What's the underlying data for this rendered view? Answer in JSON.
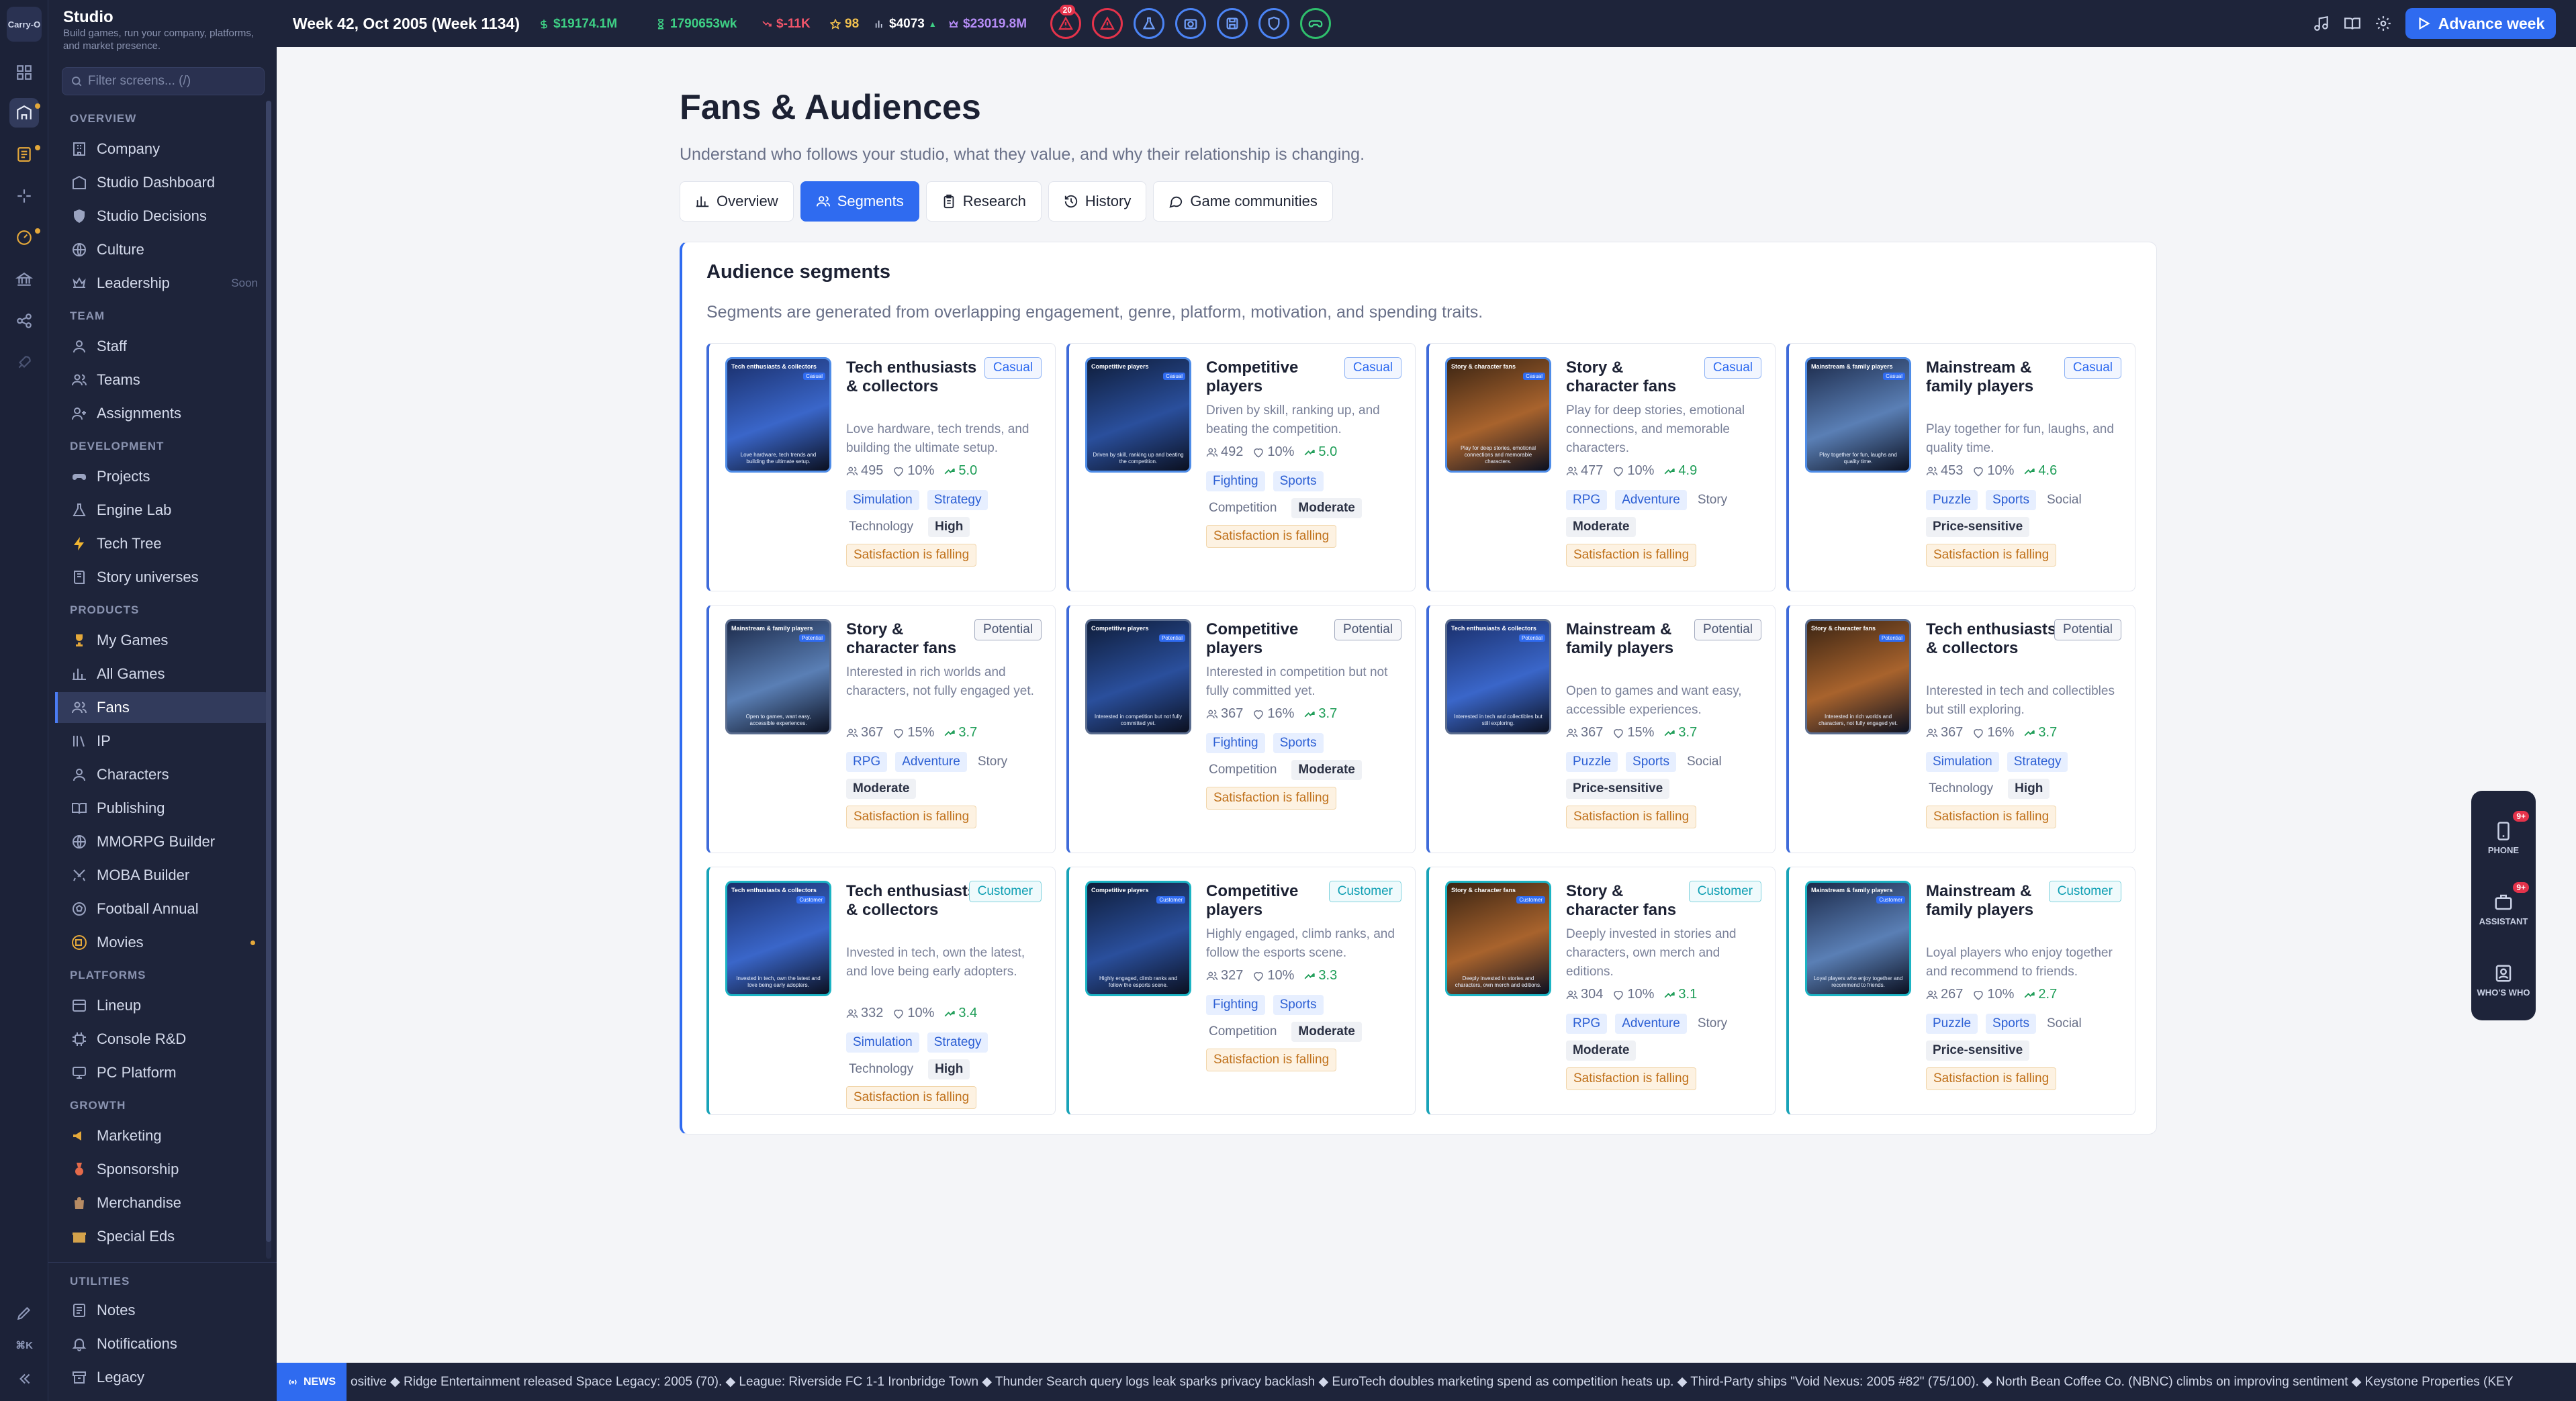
{
  "app": {
    "name": "Studio",
    "subtitle": "Build games, run your company, platforms, and market presence.",
    "filter_placeholder": "Filter screens... (/)",
    "logo_text": "Carry-O"
  },
  "topbar": {
    "week": "Week 42, Oct 2005 (Week 1134)",
    "cash": "$19174.1M",
    "weekly": "1790653wk",
    "delta": "$-11K",
    "reputation": "98",
    "price": "$4073",
    "valuation": "$23019.8M",
    "alert_badge": "20",
    "advance_label": "Advance week"
  },
  "sidebar": {
    "sections": [
      {
        "label": "OVERVIEW",
        "items": [
          {
            "label": "Company",
            "icon": "building-icon"
          },
          {
            "label": "Studio Dashboard",
            "icon": "dashboard-icon"
          },
          {
            "label": "Studio Decisions",
            "icon": "shield-icon"
          },
          {
            "label": "Culture",
            "icon": "globe-icon"
          },
          {
            "label": "Leadership",
            "icon": "crown-icon",
            "note": "Soon"
          }
        ]
      },
      {
        "label": "TEAM",
        "items": [
          {
            "label": "Staff",
            "icon": "user-icon"
          },
          {
            "label": "Teams",
            "icon": "users-icon"
          },
          {
            "label": "Assignments",
            "icon": "user-plus-icon"
          }
        ]
      },
      {
        "label": "DEVELOPMENT",
        "items": [
          {
            "label": "Projects",
            "icon": "gamepad-icon"
          },
          {
            "label": "Engine Lab",
            "icon": "flask-icon"
          },
          {
            "label": "Tech Tree",
            "icon": "bolt-icon"
          },
          {
            "label": "Story universes",
            "icon": "book-icon"
          }
        ]
      },
      {
        "label": "PRODUCTS",
        "items": [
          {
            "label": "My Games",
            "icon": "trophy-icon"
          },
          {
            "label": "All Games",
            "icon": "bar-chart-icon"
          },
          {
            "label": "Fans",
            "icon": "users-icon",
            "active": true
          },
          {
            "label": "IP",
            "icon": "library-icon"
          },
          {
            "label": "Characters",
            "icon": "user-icon"
          },
          {
            "label": "Publishing",
            "icon": "book-open-icon"
          },
          {
            "label": "MMORPG Builder",
            "icon": "globe-icon"
          },
          {
            "label": "MOBA Builder",
            "icon": "swords-icon"
          },
          {
            "label": "Football Annual",
            "icon": "ball-icon"
          },
          {
            "label": "Movies",
            "icon": "film-icon",
            "dot": true
          }
        ]
      },
      {
        "label": "PLATFORMS",
        "items": [
          {
            "label": "Lineup",
            "icon": "layers-icon"
          },
          {
            "label": "Console R&D",
            "icon": "chip-icon"
          },
          {
            "label": "PC Platform",
            "icon": "monitor-icon"
          }
        ]
      },
      {
        "label": "GROWTH",
        "items": [
          {
            "label": "Marketing",
            "icon": "megaphone-icon"
          },
          {
            "label": "Sponsorship",
            "icon": "medal-icon"
          },
          {
            "label": "Merchandise",
            "icon": "bag-icon"
          },
          {
            "label": "Special Eds",
            "icon": "gift-icon"
          }
        ]
      }
    ],
    "utilities_label": "UTILITIES",
    "utilities": [
      {
        "label": "Notes",
        "icon": "notes-icon"
      },
      {
        "label": "Notifications",
        "icon": "bell-icon"
      },
      {
        "label": "Legacy",
        "icon": "archive-icon"
      }
    ],
    "shortcut": "⌘K"
  },
  "page": {
    "title": "Fans & Audiences",
    "description": "Understand who follows your studio, what they value, and why their relationship is changing.",
    "tabs": [
      {
        "label": "Overview",
        "icon": "bar-chart-icon"
      },
      {
        "label": "Segments",
        "icon": "users-icon",
        "active": true
      },
      {
        "label": "Research",
        "icon": "clipboard-icon"
      },
      {
        "label": "History",
        "icon": "history-icon"
      },
      {
        "label": "Game communities",
        "icon": "chat-icon"
      }
    ]
  },
  "panel": {
    "title": "Audience segments",
    "description": "Segments are generated from overlapping engagement, genre, platform, motivation, and spending traits."
  },
  "segments": [
    {
      "name": "Tech enthusiasts & collectors",
      "kind": "Casual",
      "desc": "Love hardware, tech trends, and building the ultimate setup.",
      "size": "495",
      "share": "10%",
      "trend": "5.0",
      "tags": [
        "Simulation",
        "Strategy"
      ],
      "trait": "Technology",
      "level": "High",
      "warning": "Satisfaction is falling",
      "thumb_head": "Tech enthusiasts & collectors",
      "thumb_chip": "Casual",
      "thumb_cap": "Love hardware, tech trends and building the ultimate setup."
    },
    {
      "name": "Competitive players",
      "kind": "Casual",
      "desc": "Driven by skill, ranking up, and beating the competition.",
      "size": "492",
      "share": "10%",
      "trend": "5.0",
      "tags": [
        "Fighting",
        "Sports"
      ],
      "trait": "Competition",
      "level": "Moderate",
      "warning": "Satisfaction is falling",
      "thumb_head": "Competitive players",
      "thumb_chip": "Casual",
      "thumb_cap": "Driven by skill, ranking up and beating the competition."
    },
    {
      "name": "Story & character fans",
      "kind": "Casual",
      "desc": "Play for deep stories, emotional connections, and memorable characters.",
      "size": "477",
      "share": "10%",
      "trend": "4.9",
      "tags": [
        "RPG",
        "Adventure"
      ],
      "trait": "Story",
      "level": "Moderate",
      "warning": "Satisfaction is falling",
      "thumb_head": "Story & character fans",
      "thumb_chip": "Casual",
      "thumb_cap": "Play for deep stories, emotional connections and memorable characters."
    },
    {
      "name": "Mainstream & family players",
      "kind": "Casual",
      "desc": "Play together for fun, laughs, and quality time.",
      "size": "453",
      "share": "10%",
      "trend": "4.6",
      "tags": [
        "Puzzle",
        "Sports"
      ],
      "trait": "Social",
      "level": "Price-sensitive",
      "warning": "Satisfaction is falling",
      "thumb_head": "Mainstream & family players",
      "thumb_chip": "Casual",
      "thumb_cap": "Play together for fun, laughs and quality time."
    },
    {
      "name": "Story & character fans",
      "kind": "Potential",
      "desc": "Interested in rich worlds and characters, not fully engaged yet.",
      "size": "367",
      "share": "15%",
      "trend": "3.7",
      "tags": [
        "RPG",
        "Adventure"
      ],
      "trait": "Story",
      "level": "Moderate",
      "warning": "Satisfaction is falling",
      "thumb_head": "Mainstream & family players",
      "thumb_chip": "Potential",
      "thumb_cap": "Open to games, want easy, accessible experiences."
    },
    {
      "name": "Competitive players",
      "kind": "Potential",
      "desc": "Interested in competition but not fully committed yet.",
      "size": "367",
      "share": "16%",
      "trend": "3.7",
      "tags": [
        "Fighting",
        "Sports"
      ],
      "trait": "Competition",
      "level": "Moderate",
      "warning": "Satisfaction is falling",
      "thumb_head": "Competitive players",
      "thumb_chip": "Potential",
      "thumb_cap": "Interested in competition but not fully committed yet."
    },
    {
      "name": "Mainstream & family players",
      "kind": "Potential",
      "desc": "Open to games and want easy, accessible experiences.",
      "size": "367",
      "share": "15%",
      "trend": "3.7",
      "tags": [
        "Puzzle",
        "Sports"
      ],
      "trait": "Social",
      "level": "Price-sensitive",
      "warning": "Satisfaction is falling",
      "thumb_head": "Tech enthusiasts & collectors",
      "thumb_chip": "Potential",
      "thumb_cap": "Interested in tech and collectibles but still exploring."
    },
    {
      "name": "Tech enthusiasts & collectors",
      "kind": "Potential",
      "desc": "Interested in tech and collectibles but still exploring.",
      "size": "367",
      "share": "16%",
      "trend": "3.7",
      "tags": [
        "Simulation",
        "Strategy"
      ],
      "trait": "Technology",
      "level": "High",
      "warning": "Satisfaction is falling",
      "thumb_head": "Story & character fans",
      "thumb_chip": "Potential",
      "thumb_cap": "Interested in rich worlds and characters, not fully engaged yet."
    },
    {
      "name": "Tech enthusiasts & collectors",
      "kind": "Customer",
      "desc": "Invested in tech, own the latest, and love being early adopters.",
      "size": "332",
      "share": "10%",
      "trend": "3.4",
      "tags": [
        "Simulation",
        "Strategy"
      ],
      "trait": "Technology",
      "level": "High",
      "warning": "Satisfaction is falling",
      "thumb_head": "Tech enthusiasts & collectors",
      "thumb_chip": "Customer",
      "thumb_cap": "Invested in tech, own the latest and love being early adopters."
    },
    {
      "name": "Competitive players",
      "kind": "Customer",
      "desc": "Highly engaged, climb ranks, and follow the esports scene.",
      "size": "327",
      "share": "10%",
      "trend": "3.3",
      "tags": [
        "Fighting",
        "Sports"
      ],
      "trait": "Competition",
      "level": "Moderate",
      "warning": "Satisfaction is falling",
      "thumb_head": "Competitive players",
      "thumb_chip": "Customer",
      "thumb_cap": "Highly engaged, climb ranks and follow the esports scene."
    },
    {
      "name": "Story & character fans",
      "kind": "Customer",
      "desc": "Deeply invested in stories and characters, own merch and editions.",
      "size": "304",
      "share": "10%",
      "trend": "3.1",
      "tags": [
        "RPG",
        "Adventure"
      ],
      "trait": "Story",
      "level": "Moderate",
      "warning": "Satisfaction is falling",
      "thumb_head": "Story & character fans",
      "thumb_chip": "Customer",
      "thumb_cap": "Deeply invested in stories and characters, own merch and editions."
    },
    {
      "name": "Mainstream & family players",
      "kind": "Customer",
      "desc": "Loyal players who enjoy together and recommend to friends.",
      "size": "267",
      "share": "10%",
      "trend": "2.7",
      "tags": [
        "Puzzle",
        "Sports"
      ],
      "trait": "Social",
      "level": "Price-sensitive",
      "warning": "Satisfaction is falling",
      "thumb_head": "Mainstream & family players",
      "thumb_chip": "Customer",
      "thumb_cap": "Loyal players who enjoy together and recommend to friends."
    }
  ],
  "dock": [
    {
      "label": "PHONE",
      "badge": "9+"
    },
    {
      "label": "ASSISTANT",
      "badge": "9+"
    },
    {
      "label": "WHO'S WHO",
      "badge": ""
    }
  ],
  "news": {
    "label": "NEWS",
    "text": "ositive ◆ Ridge Entertainment released Space Legacy: 2005 (70). ◆ League: Riverside FC 1-1 Ironbridge Town ◆ Thunder Search query logs leak sparks privacy backlash ◆ EuroTech doubles marketing spend as competition heats up. ◆ Third-Party ships \"Void Nexus: 2005 #82\" (75/100). ◆ North Bean Coffee Co. (NBNC) climbs on improving sentiment ◆ Keystone Properties (KEY"
  },
  "colors": {
    "accent": "#2f6bf0",
    "sidebar": "#1e243a",
    "positive": "#1e9d57",
    "negative": "#e5334b",
    "warning": "#c0711b"
  }
}
